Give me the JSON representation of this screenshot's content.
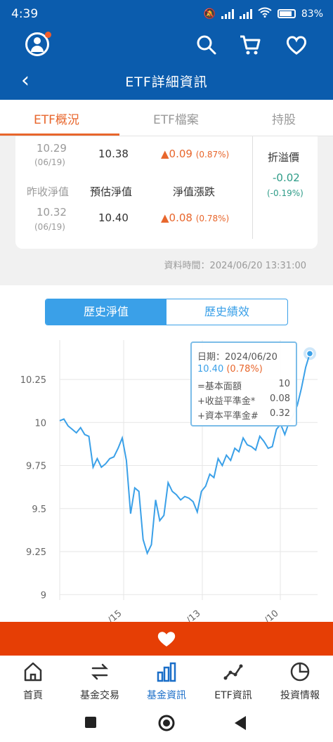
{
  "status_bar": {
    "time": "4:39",
    "battery": "83%"
  },
  "header": {
    "title": "ETF詳細資訊"
  },
  "tabs": [
    {
      "label": "ETF概況",
      "active": true
    },
    {
      "label": "ETF檔案",
      "active": false
    },
    {
      "label": "持股",
      "active": false
    }
  ],
  "quote": {
    "row1": {
      "price": "10.29",
      "date": "(06/19)",
      "value": "10.38",
      "change": "▲0.09",
      "change_pct": "(0.87%)"
    },
    "row2_labels": {
      "col1": "昨收淨值",
      "col2": "預估淨值",
      "col3": "淨值漲跌"
    },
    "row2": {
      "price": "10.32",
      "date": "(06/19)",
      "value": "10.40",
      "change": "▲0.08",
      "change_pct": "(0.78%)"
    },
    "premium": {
      "label": "折溢價",
      "value": "-0.02",
      "pct": "(-0.19%)"
    },
    "data_time": "資料時間：2024/06/20 13:31:00"
  },
  "segmented": {
    "left": "歷史淨值",
    "right": "歷史績效"
  },
  "tooltip": {
    "date": "日期：2024/06/20",
    "value": "10.40",
    "pct": "(0.78%)",
    "rows": [
      {
        "label": "=基本面額",
        "value": "10"
      },
      {
        "label": "+收益平準金*",
        "value": "0.08"
      },
      {
        "label": "+資本平準金#",
        "value": "0.32"
      }
    ]
  },
  "chart_data": {
    "type": "line",
    "y_ticks": [
      "10.25",
      "10",
      "9.75",
      "9.5",
      "9.25",
      "9"
    ],
    "ylim": [
      9,
      10.5
    ],
    "x_ticks": [
      "/15",
      "/13",
      "/10"
    ],
    "series": [
      {
        "values": [
          10.01,
          10.02,
          9.98,
          9.96,
          9.94,
          9.97,
          9.93,
          9.92,
          9.74,
          9.79,
          9.74,
          9.76,
          9.79,
          9.8,
          9.85,
          9.91,
          9.78,
          9.47,
          9.62,
          9.6,
          9.32,
          9.24,
          9.29,
          9.55,
          9.43,
          9.46,
          9.65,
          9.6,
          9.58,
          9.55,
          9.57,
          9.56,
          9.54,
          9.48,
          9.6,
          9.63,
          9.7,
          9.68,
          9.79,
          9.75,
          9.81,
          9.78,
          9.85,
          9.83,
          9.91,
          9.87,
          9.86,
          9.84,
          9.92,
          9.89,
          9.85,
          9.86,
          9.96,
          9.99,
          9.93,
          10.0,
          10.04,
          10.1,
          10.2,
          10.32,
          10.4
        ]
      }
    ],
    "highlight": {
      "label": "2024/06/20",
      "value": 10.4
    },
    "colors": {
      "line": "#3aa0e8",
      "grid": "#e6e6e6"
    }
  },
  "bottom_nav": [
    {
      "label": "首頁",
      "icon": "home-icon",
      "active": false
    },
    {
      "label": "基金交易",
      "icon": "swap-icon",
      "active": false
    },
    {
      "label": "基金資訊",
      "icon": "bar-chart-icon",
      "active": true
    },
    {
      "label": "ETF資訊",
      "icon": "line-chart-icon",
      "active": false
    },
    {
      "label": "投資情報",
      "icon": "pie-chart-icon",
      "active": false
    }
  ]
}
